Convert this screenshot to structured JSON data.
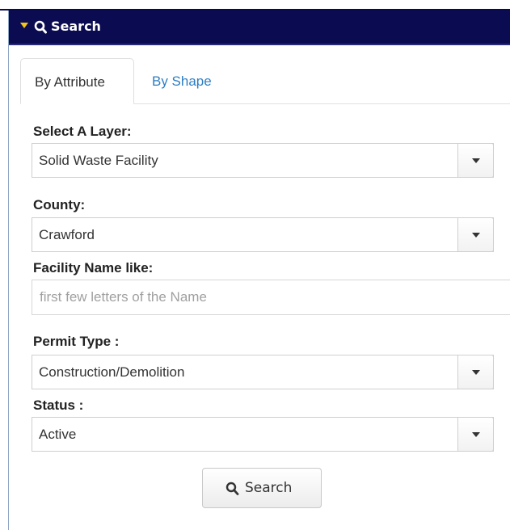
{
  "panel": {
    "title": "Search",
    "accent_color": "#0b0b52",
    "collapse_icon_color": "#f0c419"
  },
  "tabs": [
    {
      "label": "By Attribute",
      "active": true
    },
    {
      "label": "By Shape",
      "active": false
    }
  ],
  "form": {
    "layer": {
      "label": "Select A Layer:",
      "value": "Solid Waste Facility"
    },
    "county": {
      "label": "County:",
      "value": "Crawford"
    },
    "facility_name": {
      "label": "Facility Name like:",
      "value": "",
      "placeholder": "first few letters of the Name"
    },
    "permit_type": {
      "label": "Permit Type :",
      "value": "Construction/Demolition"
    },
    "status": {
      "label": "Status :",
      "value": "Active"
    }
  },
  "search_button": {
    "label": "Search",
    "icon": "search-icon"
  },
  "link_color": "#2d7ec3"
}
